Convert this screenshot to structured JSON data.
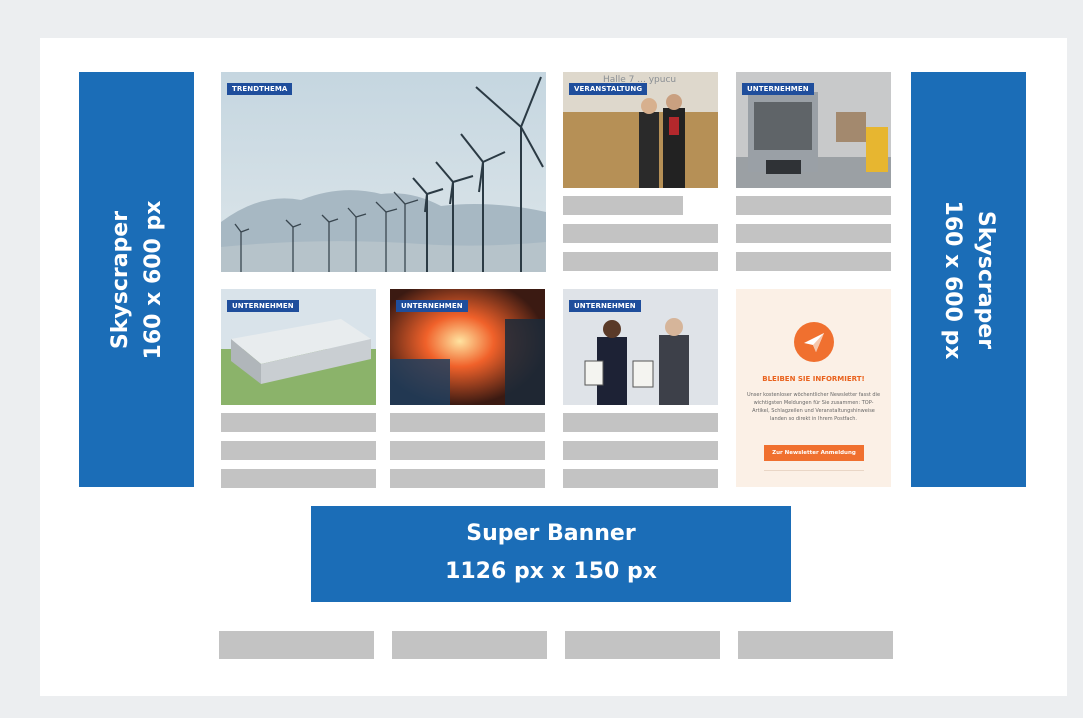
{
  "skyscraper_left": {
    "line1": "Skyscraper",
    "line2": "160 x 600 px"
  },
  "skyscraper_right": {
    "line1": "Skyscraper",
    "line2": "160 x 600 px"
  },
  "banner": {
    "line1": "Super Banner",
    "line2": "1126 px x 150 px"
  },
  "tiles": {
    "t1": {
      "badge": "TRENDTHEMA"
    },
    "t2": {
      "badge": "VERANSTALTUNG",
      "sign": "Halle 7 ... ypucu"
    },
    "t3": {
      "badge": "UNTERNEHMEN"
    },
    "t4": {
      "badge": "UNTERNEHMEN"
    },
    "t5": {
      "badge": "UNTERNEHMEN"
    },
    "t6": {
      "badge": "UNTERNEHMEN"
    }
  },
  "newsletter": {
    "title": "BLEIBEN SIE INFORMIERT!",
    "body": "Unser kostenloser wöchentlicher Newsletter fasst die wichtigsten Meldungen für Sie zusammen: TOP-Artikel, Schlagzeilen und Veranstaltungshinweise landen so direkt in Ihrem Postfach.",
    "button": "Zur Newsletter Anmeldung",
    "icon": "paper-plane-icon"
  },
  "colors": {
    "ad_blue": "#1b6db7",
    "badge_blue": "#1f4e9c",
    "placeholder_gray": "#c3c3c3",
    "newsletter_orange": "#f0702f"
  }
}
